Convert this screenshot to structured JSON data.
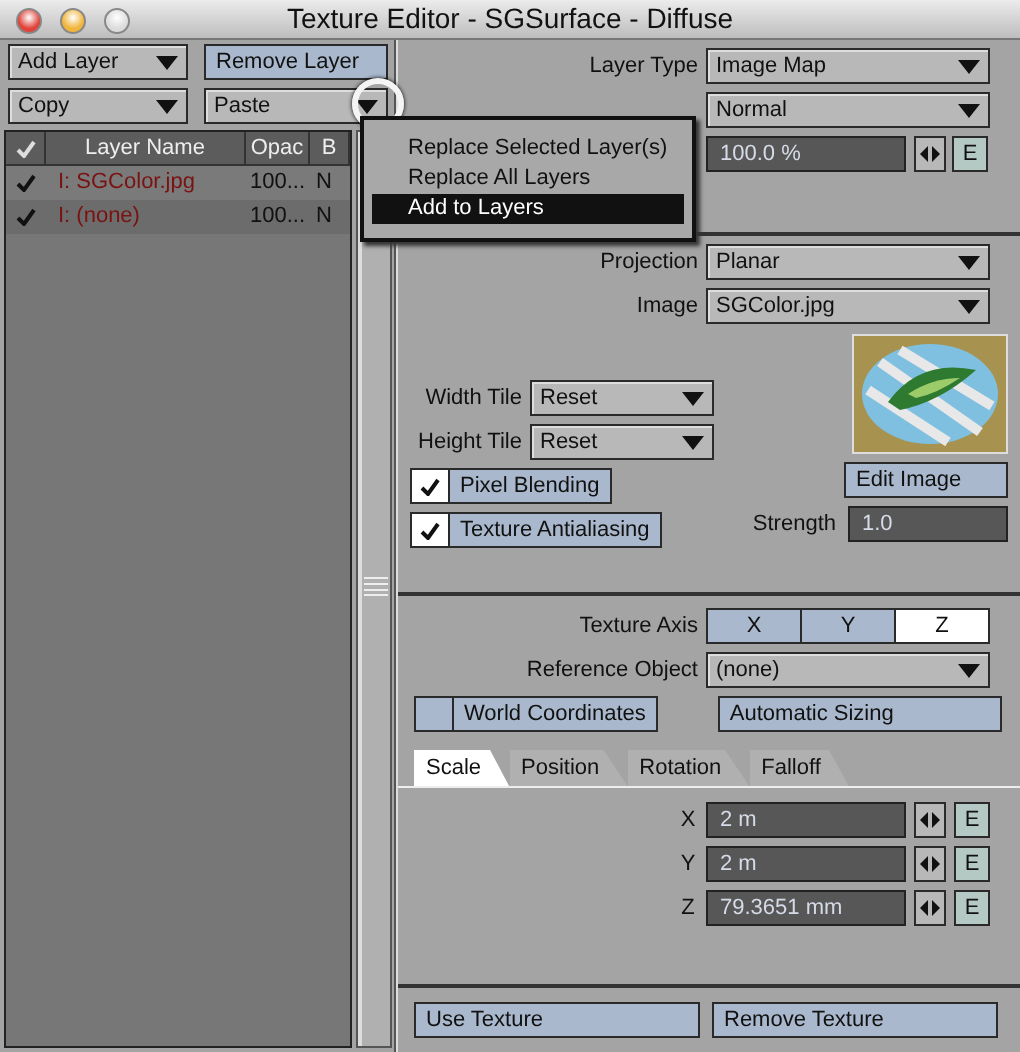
{
  "window": {
    "title": "Texture Editor - SGSurface - Diffuse"
  },
  "toolbar": [
    {
      "label": "Add Layer",
      "kind": "dropdown"
    },
    {
      "label": "Remove Layer",
      "kind": "button"
    },
    {
      "label": "Copy",
      "kind": "dropdown"
    },
    {
      "label": "Paste",
      "kind": "dropdown"
    }
  ],
  "layers": {
    "columns": [
      "Layer Name",
      "Opac",
      "B"
    ],
    "rows": [
      {
        "checked": true,
        "name": "I: SGColor.jpg",
        "opacity": "100...",
        "blend": "N",
        "selected": false
      },
      {
        "checked": true,
        "name": "I: (none)",
        "opacity": "100...",
        "blend": "N",
        "selected": true
      }
    ]
  },
  "paste_menu": [
    {
      "label": "Replace Selected Layer(s)",
      "selected": false
    },
    {
      "label": "Replace All Layers",
      "selected": false
    },
    {
      "label": "Add to Layers",
      "selected": true
    }
  ],
  "layer": {
    "layer_type_label": "Layer Type",
    "layer_type": "Image Map",
    "blending_mode": "Normal",
    "opacity": "100.0 %",
    "opacity_envelope": "E"
  },
  "image_settings": {
    "projection_label": "Projection",
    "projection": "Planar",
    "image_label": "Image",
    "image": "SGColor.jpg",
    "width_tile_label": "Width Tile",
    "width_tile": "Reset",
    "height_tile_label": "Height Tile",
    "height_tile": "Reset",
    "checkboxes": [
      {
        "label": "Pixel Blending",
        "checked": true
      },
      {
        "label": "Texture Antialiasing",
        "checked": true
      }
    ],
    "edit_image": "Edit Image",
    "strength_label": "Strength",
    "strength": "1.0"
  },
  "axis": {
    "texture_axis_label": "Texture Axis",
    "options": [
      {
        "label": "X",
        "selected": false
      },
      {
        "label": "Y",
        "selected": false
      },
      {
        "label": "Z",
        "selected": true
      }
    ],
    "reference_object_label": "Reference Object",
    "reference_object": "(none)",
    "world_coordinates": {
      "label": "World Coordinates",
      "checked": false
    },
    "automatic_sizing": "Automatic Sizing"
  },
  "tabs": [
    {
      "label": "Scale",
      "selected": true
    },
    {
      "label": "Position",
      "selected": false
    },
    {
      "label": "Rotation",
      "selected": false
    },
    {
      "label": "Falloff",
      "selected": false
    }
  ],
  "scale": [
    {
      "axis": "X",
      "value": "2 m",
      "envelope": "E"
    },
    {
      "axis": "Y",
      "value": "2 m",
      "envelope": "E"
    },
    {
      "axis": "Z",
      "value": "79.3651 mm",
      "envelope": "E"
    }
  ],
  "bottom_buttons": [
    "Use Texture",
    "Remove Texture"
  ]
}
